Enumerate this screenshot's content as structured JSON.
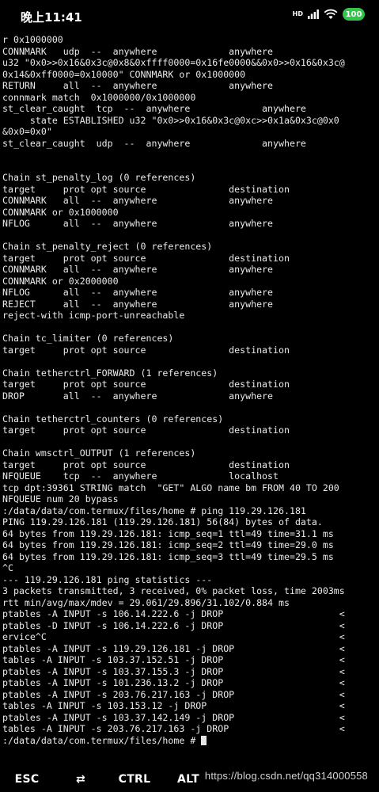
{
  "status_bar": {
    "time": "晚上11:41",
    "network_label": "HD",
    "battery_level": "100",
    "signal_icon": "signal-icon",
    "wifi_icon": "wifi-icon"
  },
  "terminal": {
    "lines": [
      "r 0x1000000",
      "CONNMARK   udp  --  anywhere             anywhere",
      "u32 \"0x0>>0x16&0x3c@0x8&0xffff0000=0x16fe0000&&0x0>>0x16&0x3c@",
      "0x14&0xff0000=0x10000\" CONNMARK or 0x1000000",
      "RETURN     all  --  anywhere             anywhere",
      "connmark match  0x1000000/0x1000000",
      "st_clear_caught  tcp  --  anywhere             anywhere",
      "     state ESTABLISHED u32 \"0x0>>0x16&0x3c@0xc>>0x1a&0x3c@0x0",
      "&0x0=0x0\"",
      "st_clear_caught  udp  --  anywhere             anywhere",
      "",
      "",
      "Chain st_penalty_log (0 references)",
      "target     prot opt source               destination",
      "CONNMARK   all  --  anywhere             anywhere",
      "CONNMARK or 0x1000000",
      "NFLOG      all  --  anywhere             anywhere",
      "",
      "Chain st_penalty_reject (0 references)",
      "target     prot opt source               destination",
      "CONNMARK   all  --  anywhere             anywhere",
      "CONNMARK or 0x2000000",
      "NFLOG      all  --  anywhere             anywhere",
      "REJECT     all  --  anywhere             anywhere",
      "reject-with icmp-port-unreachable",
      "",
      "Chain tc_limiter (0 references)",
      "target     prot opt source               destination",
      "",
      "Chain tetherctrl_FORWARD (1 references)",
      "target     prot opt source               destination",
      "DROP       all  --  anywhere             anywhere",
      "",
      "Chain tetherctrl_counters (0 references)",
      "target     prot opt source               destination",
      "",
      "Chain wmsctrl_OUTPUT (1 references)",
      "target     prot opt source               destination",
      "NFQUEUE    tcp  --  anywhere             localhost",
      "tcp dpt:39361 STRING match  \"GET\" ALGO name bm FROM 40 TO 200",
      "NFQUEUE num 20 bypass",
      ":/data/data/com.termux/files/home # ping 119.29.126.181",
      "PING 119.29.126.181 (119.29.126.181) 56(84) bytes of data.",
      "64 bytes from 119.29.126.181: icmp_seq=1 ttl=49 time=31.1 ms",
      "64 bytes from 119.29.126.181: icmp_seq=2 ttl=49 time=29.0 ms",
      "64 bytes from 119.29.126.181: icmp_seq=3 ttl=49 time=29.5 ms",
      "^C",
      "--- 119.29.126.181 ping statistics ---",
      "3 packets transmitted, 3 received, 0% packet loss, time 2003ms",
      "rtt min/avg/max/mdev = 29.061/29.896/31.102/0.884 ms",
      "ptables -A INPUT -s 106.14.222.6 -j DROP                     <",
      "ptables -D INPUT -s 106.14.222.6 -j DROP                     <",
      "ervice^C                                                     <",
      "ptables -A INPUT -s 119.29.126.181 -j DROP                   <",
      "tables -A INPUT -s 103.37.152.51 -j DROP                     <",
      "ptables -A INPUT -s 103.37.155.3 -j DROP                     <",
      "ptables -A INPUT -s 101.236.13.2 -j DROP                     <",
      "ptables -A INPUT -s 203.76.217.163 -j DROP                   <",
      "tables -A INPUT -s 103.153.12 -j DROP                        <",
      "ptables -A INPUT -s 103.37.142.149 -j DROP                   <",
      "tables -A INPUT -s 203.76.217.163 -j DROP                    <"
    ],
    "prompt": ":/data/data/com.termux/files/home # "
  },
  "extra_keys": {
    "esc": "ESC",
    "tab": "⇄",
    "ctrl": "CTRL",
    "alt": "ALT"
  },
  "watermark": "https://blog.csdn.net/qq314000558"
}
